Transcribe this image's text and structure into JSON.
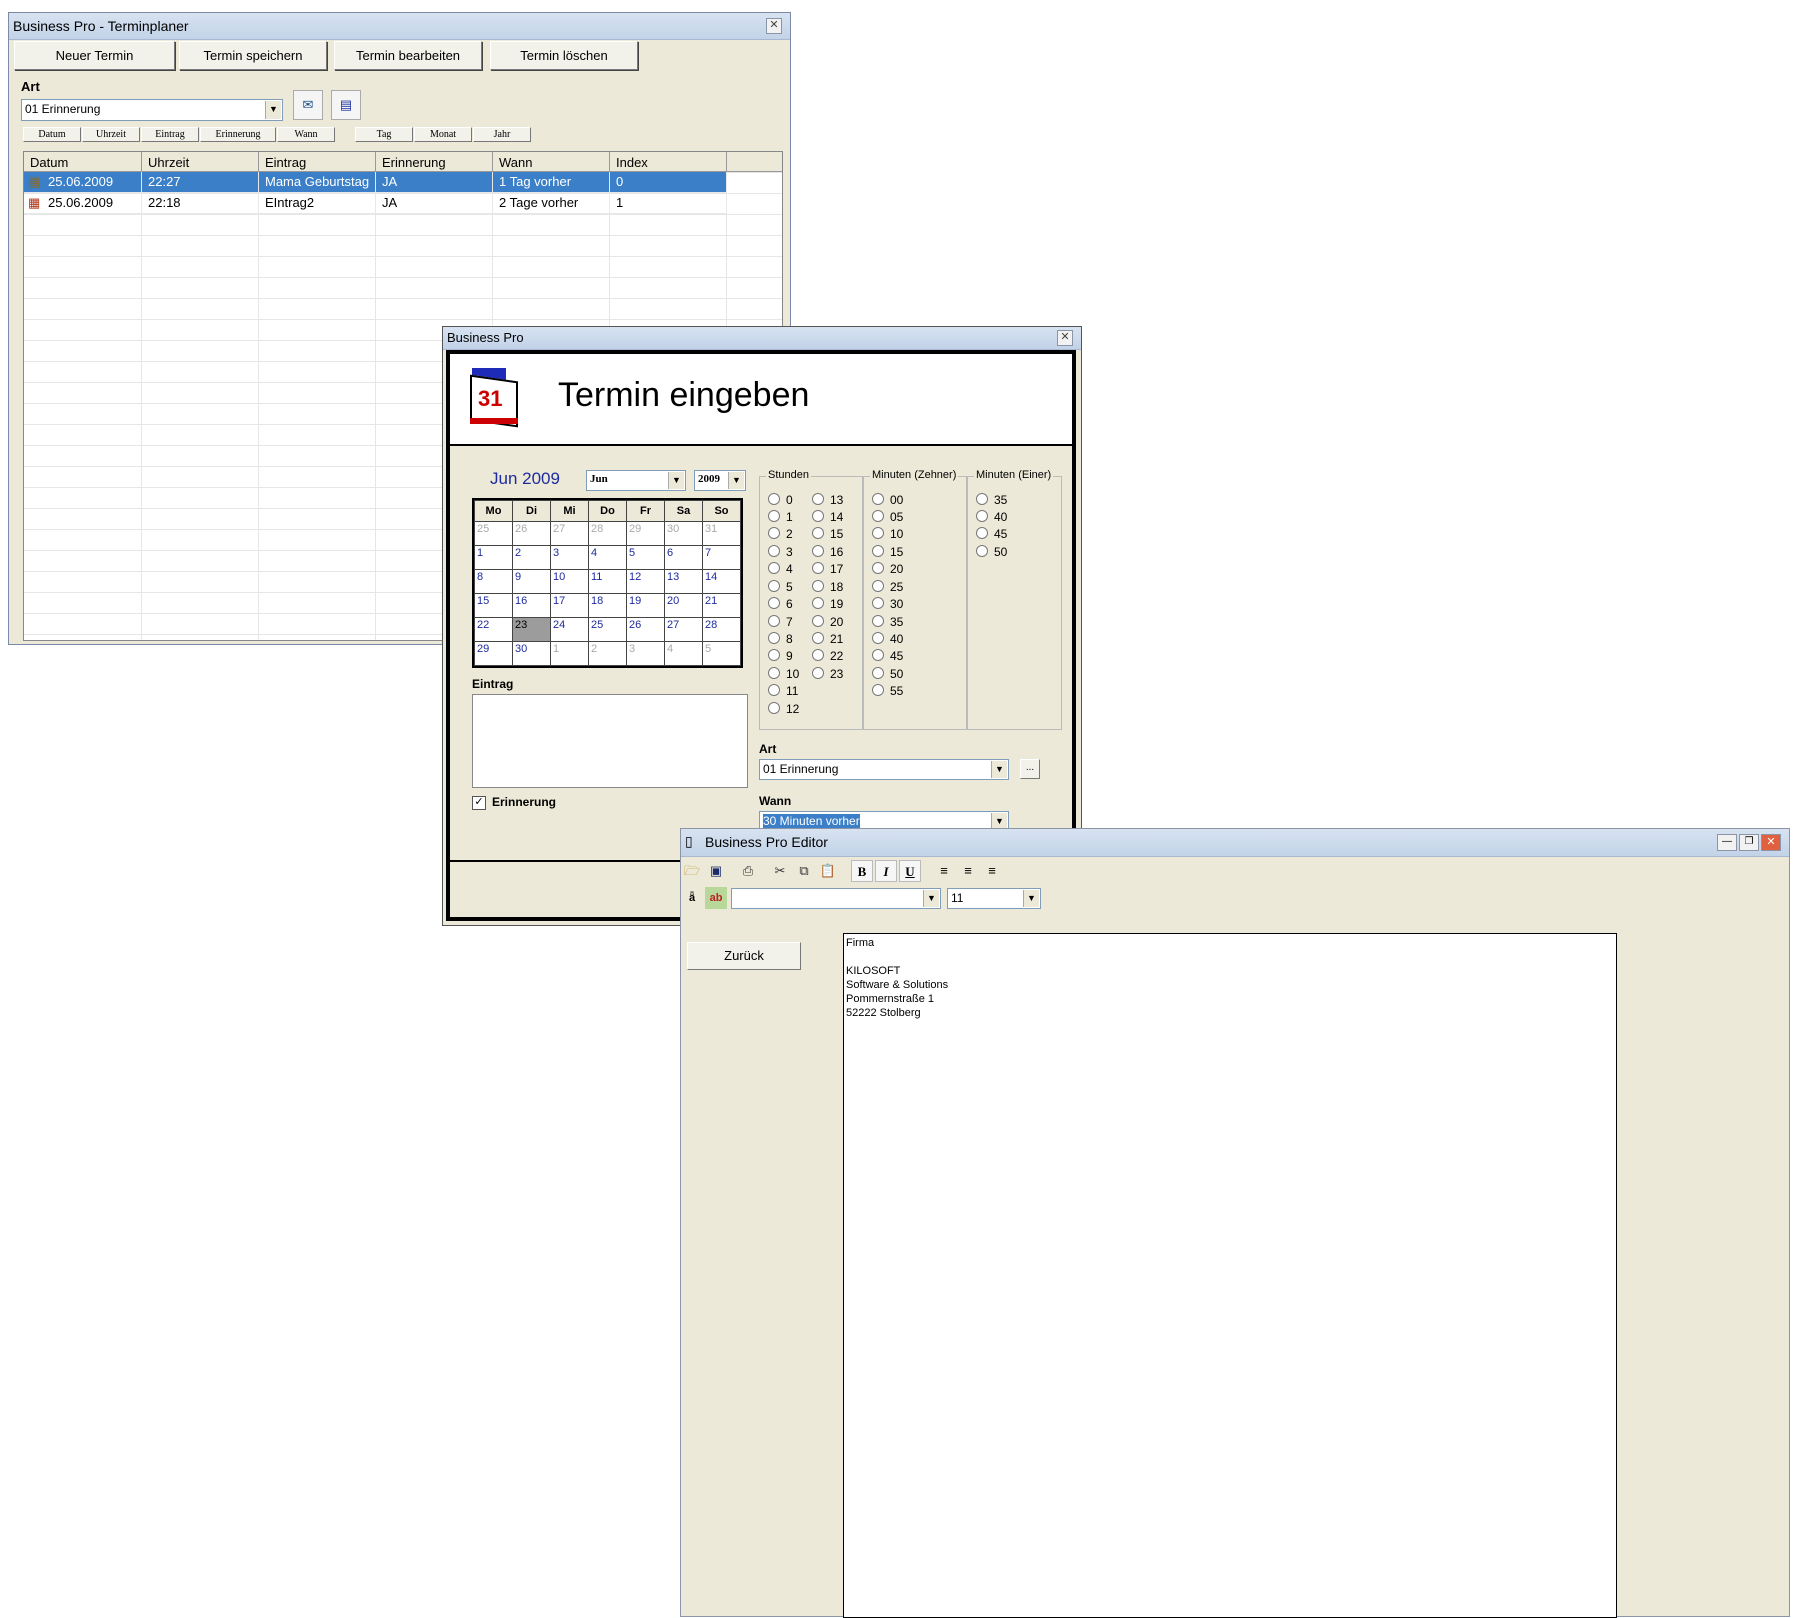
{
  "win1": {
    "title": "Business Pro - Terminplaner",
    "buttons": [
      "Neuer Termin",
      "Termin speichern",
      "Termin bearbeiten",
      "Termin löschen"
    ],
    "art_label": "Art",
    "art_value": "01 Erinnerung",
    "sort_buttons": [
      "Datum",
      "Uhrzeit",
      "Eintrag",
      "Erinnerung",
      "Wann",
      "Tag",
      "Monat",
      "Jahr"
    ],
    "columns": [
      "Datum",
      "Uhrzeit",
      "Eintrag",
      "Erinnerung",
      "Wann",
      "Index"
    ],
    "rows": [
      [
        "25.06.2009",
        "22:27",
        "Mama Geburtstag",
        "JA",
        "1 Tag vorher",
        "0"
      ],
      [
        "25.06.2009",
        "22:18",
        "EIntrag2",
        "JA",
        "2 Tage vorher",
        "1"
      ]
    ]
  },
  "win2": {
    "title": "Business Pro",
    "heading": "Termin eingeben",
    "calendar": {
      "month_title": "Jun 2009",
      "month_select": "Jun",
      "year_select": "2009",
      "weekdays": [
        "Mo",
        "Di",
        "Mi",
        "Do",
        "Fr",
        "Sa",
        "So"
      ],
      "weeks": [
        [
          "25",
          "26",
          "27",
          "28",
          "29",
          "30",
          "31"
        ],
        [
          "1",
          "2",
          "3",
          "4",
          "5",
          "6",
          "7"
        ],
        [
          "8",
          "9",
          "10",
          "11",
          "12",
          "13",
          "14"
        ],
        [
          "15",
          "16",
          "17",
          "18",
          "19",
          "20",
          "21"
        ],
        [
          "22",
          "23",
          "24",
          "25",
          "26",
          "27",
          "28"
        ],
        [
          "29",
          "30",
          "1",
          "2",
          "3",
          "4",
          "5"
        ]
      ]
    },
    "stunden_label": "Stunden",
    "stunden_col1": [
      "0",
      "1",
      "2",
      "3",
      "4",
      "5",
      "6",
      "7",
      "8",
      "9",
      "10",
      "11",
      "12"
    ],
    "stunden_col2": [
      "13",
      "14",
      "15",
      "16",
      "17",
      "18",
      "19",
      "20",
      "21",
      "22",
      "23"
    ],
    "minuten_zehner_label": "Minuten (Zehner)",
    "minuten_zehner": [
      "00",
      "05",
      "10",
      "15",
      "20",
      "25",
      "30",
      "35",
      "40",
      "45",
      "50",
      "55"
    ],
    "minuten_einer_label": "Minuten (Einer)",
    "minuten_einer": [
      "35",
      "40",
      "45",
      "50"
    ],
    "eintrag_label": "Eintrag",
    "erinnerung_label": "Erinnerung",
    "art_label": "Art",
    "art_value": "01 Erinnerung",
    "ellipsis": "...",
    "wann_label": "Wann",
    "wann_value": "30 Minuten vorher"
  },
  "win3": {
    "title": "Business Pro Editor",
    "toolbar": {
      "bold": "B",
      "italic": "I",
      "underline": "U"
    },
    "font_size": "11",
    "back_button": "Zurück",
    "doc_lines": [
      "Firma",
      "",
      "KILOSOFT",
      "Software & Solutions",
      "Pommernstraße 1",
      "52222 Stolberg"
    ]
  }
}
